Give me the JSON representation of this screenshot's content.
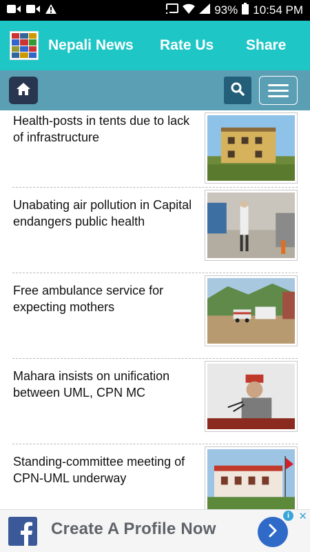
{
  "status_bar": {
    "battery_percent": "93%",
    "time": "10:54 PM",
    "left_icons": [
      "video-icon",
      "camera-icon",
      "warning-icon"
    ],
    "right_icons": [
      "cast-icon",
      "wifi-icon",
      "signal-icon",
      "battery-icon"
    ]
  },
  "app_bar": {
    "title": "Nepali News",
    "rate_label": "Rate Us",
    "share_label": "Share",
    "background": "#1fc6c6"
  },
  "toolbar": {
    "icons": [
      "home-icon",
      "search-icon",
      "menu-icon"
    ],
    "background": "#5b9fb4"
  },
  "news": [
    {
      "title": "Health-posts in tents due to lack of infrastructure"
    },
    {
      "title": "Unabating air pollution in Capital endangers public health"
    },
    {
      "title": "Free ambulance service for expecting mothers"
    },
    {
      "title": "Mahara insists on unification between UML, CPN MC"
    },
    {
      "title": "Standing-committee meeting of CPN-UML underway"
    }
  ],
  "ad": {
    "text": "Create A Profile Now",
    "info_symbol": "i",
    "close_symbol": "✕",
    "brand_color": "#3b5998"
  }
}
